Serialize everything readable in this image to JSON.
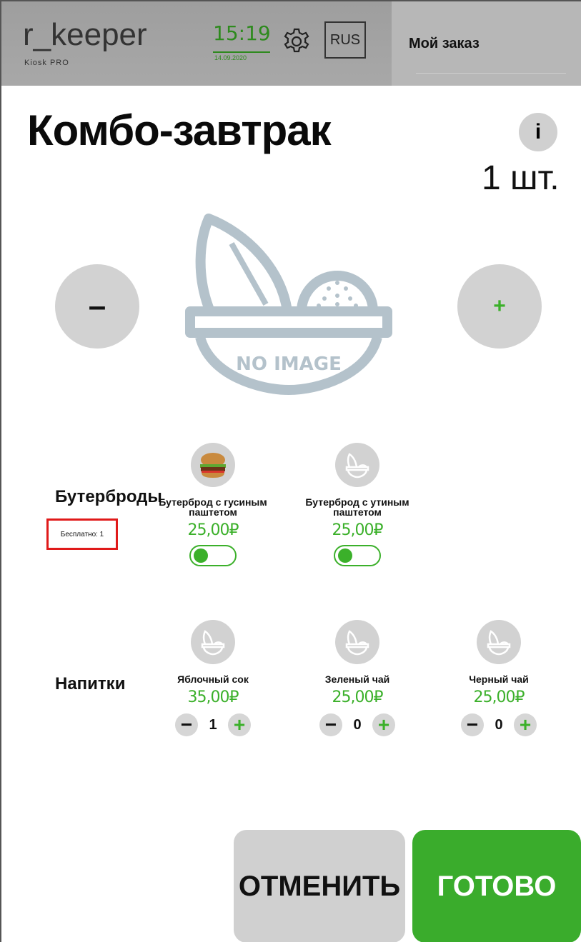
{
  "header": {
    "logo": "r_keeper",
    "logo_sub": "Kiosk PRO",
    "time": "15:19",
    "date": "14.09.2020",
    "language": "RUS",
    "order_title": "Мой заказ"
  },
  "product": {
    "title": "Комбо-завтрак",
    "info_label": "i",
    "quantity": "1 шт.",
    "minus_label": "–",
    "plus_label": "+",
    "image_placeholder_text": "NO IMAGE"
  },
  "groups": [
    {
      "label": "Бутерброды",
      "free_text": "Бесплатно: 1",
      "items": [
        {
          "name": "Бутерброд с гусиным паштетом",
          "price": "25,00₽",
          "icon": "burger-icon",
          "selected": true
        },
        {
          "name": "Бутерброд с утиным паштетом",
          "price": "25,00₽",
          "icon": "no-image-icon",
          "selected": true
        }
      ]
    },
    {
      "label": "Напитки",
      "items": [
        {
          "name": "Яблочный сок",
          "price": "35,00₽",
          "icon": "no-image-icon",
          "count": "1"
        },
        {
          "name": "Зеленый чай",
          "price": "25,00₽",
          "icon": "no-image-icon",
          "count": "0"
        },
        {
          "name": "Черный чай",
          "price": "25,00₽",
          "icon": "no-image-icon",
          "count": "0"
        }
      ]
    }
  ],
  "stepper": {
    "minus": "−",
    "plus": "+"
  },
  "actions": {
    "cancel": "ОТМЕНИТЬ",
    "done": "ГОТОВО"
  },
  "colors": {
    "accent": "#3aac2c",
    "header_bg": "#a3a3a3",
    "button_gray": "#d0d0d0",
    "highlight_red": "#e01a1a"
  }
}
